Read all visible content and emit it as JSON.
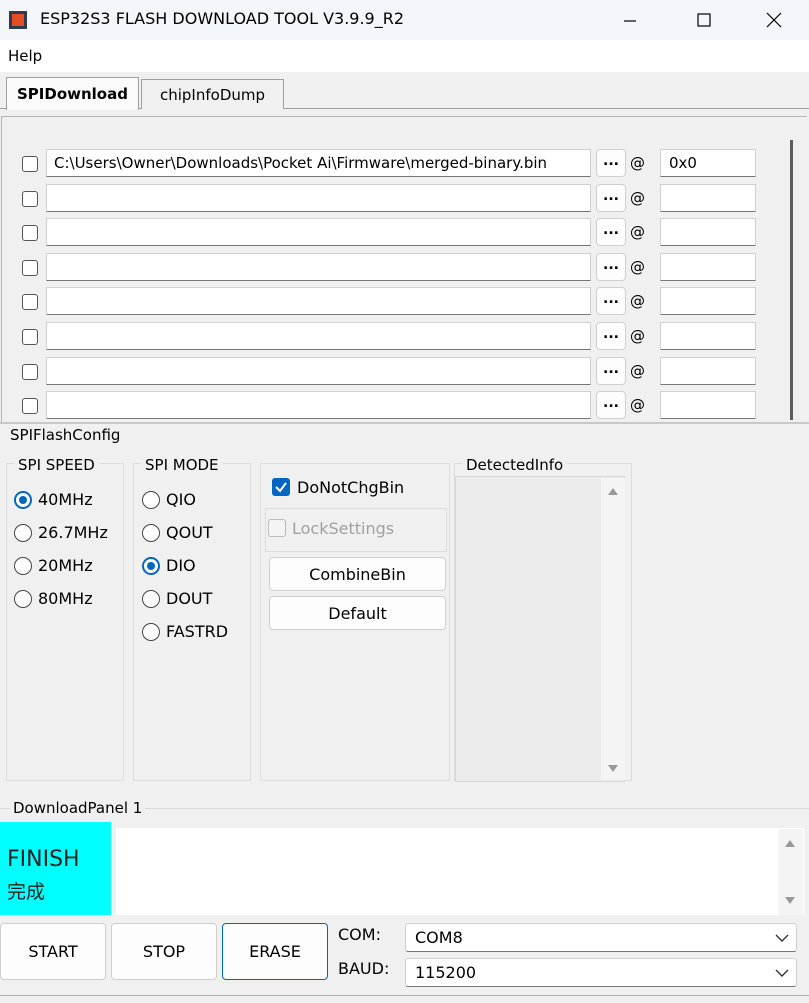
{
  "window": {
    "title": "ESP32S3 FLASH DOWNLOAD TOOL V3.9.9_R2"
  },
  "menu": {
    "help": "Help"
  },
  "tabs": [
    {
      "label": "SPIDownload",
      "active": true
    },
    {
      "label": "chipInfoDump",
      "active": false
    }
  ],
  "file_rows": [
    {
      "checked": false,
      "path": "C:\\Users\\Owner\\Downloads\\Pocket Ai\\Firmware\\merged-binary.bin",
      "browse": "...",
      "at": "@",
      "address": "0x0"
    },
    {
      "checked": false,
      "path": "",
      "browse": "...",
      "at": "@",
      "address": ""
    },
    {
      "checked": false,
      "path": "",
      "browse": "...",
      "at": "@",
      "address": ""
    },
    {
      "checked": false,
      "path": "",
      "browse": "...",
      "at": "@",
      "address": ""
    },
    {
      "checked": false,
      "path": "",
      "browse": "...",
      "at": "@",
      "address": ""
    },
    {
      "checked": false,
      "path": "",
      "browse": "...",
      "at": "@",
      "address": ""
    },
    {
      "checked": false,
      "path": "",
      "browse": "...",
      "at": "@",
      "address": ""
    },
    {
      "checked": false,
      "path": "",
      "browse": "...",
      "at": "@",
      "address": ""
    }
  ],
  "spi_flash_config": {
    "title": "SPIFlashConfig",
    "speed": {
      "title": "SPI SPEED",
      "options": [
        "40MHz",
        "26.7MHz",
        "20MHz",
        "80MHz"
      ],
      "selected": "40MHz"
    },
    "mode": {
      "title": "SPI MODE",
      "options": [
        "QIO",
        "QOUT",
        "DIO",
        "DOUT",
        "FASTRD"
      ],
      "selected": "DIO"
    },
    "do_not_chg_bin": {
      "label": "DoNotChgBin",
      "checked": true
    },
    "lock_settings": {
      "label": "LockSettings",
      "checked": false
    },
    "combine_bin": "CombineBin",
    "default": "Default",
    "detected_info": {
      "title": "DetectedInfo"
    }
  },
  "download_panel": {
    "title": "DownloadPanel 1",
    "status_en": "FINISH",
    "status_cn": "完成",
    "status_color": "#00ffff",
    "start": "START",
    "stop": "STOP",
    "erase": "ERASE",
    "com_label": "COM:",
    "com_value": "COM8",
    "baud_label": "BAUD:",
    "baud_value": "115200"
  },
  "colors": {
    "accent": "#0067c0"
  }
}
